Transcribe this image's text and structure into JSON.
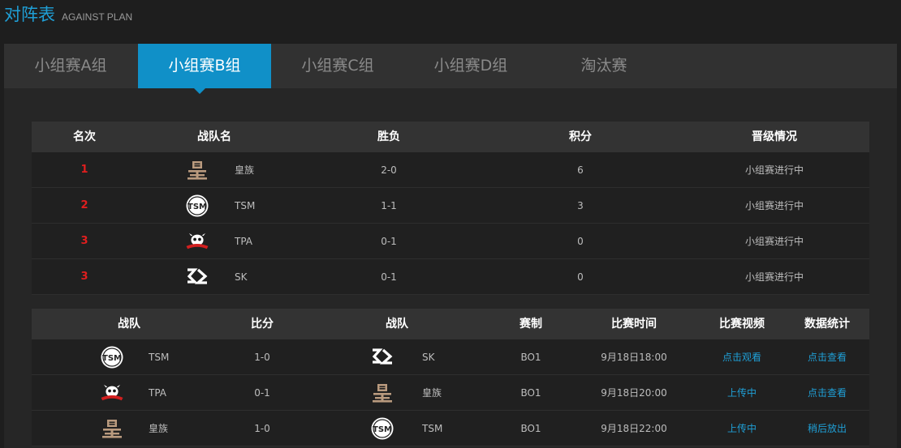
{
  "header": {
    "title": "对阵表",
    "subtitle": "AGAINST PLAN"
  },
  "tabs": [
    {
      "label": "小组赛A组",
      "active": false
    },
    {
      "label": "小组赛B组",
      "active": true
    },
    {
      "label": "小组赛C组",
      "active": false
    },
    {
      "label": "小组赛D组",
      "active": false
    },
    {
      "label": "淘汰赛",
      "active": false
    }
  ],
  "standings": {
    "headers": [
      "名次",
      "战队名",
      "胜负",
      "积分",
      "晋级情况"
    ],
    "rows": [
      {
        "rank": "1",
        "logo": "royal-club-logo",
        "team": "皇族",
        "record": "2-0",
        "points": "6",
        "status": "小组赛进行中"
      },
      {
        "rank": "2",
        "logo": "tsm-logo",
        "team": "TSM",
        "record": "1-1",
        "points": "3",
        "status": "小组赛进行中"
      },
      {
        "rank": "3",
        "logo": "tpa-logo",
        "team": "TPA",
        "record": "0-1",
        "points": "0",
        "status": "小组赛进行中"
      },
      {
        "rank": "3",
        "logo": "sk-logo",
        "team": "SK",
        "record": "0-1",
        "points": "0",
        "status": "小组赛进行中"
      }
    ]
  },
  "matches": {
    "headers": [
      "战队",
      "比分",
      "战队",
      "赛制",
      "比赛时间",
      "比赛视频",
      "数据统计"
    ],
    "rows": [
      {
        "team1_logo": "tsm-logo",
        "team1": "TSM",
        "score": "1-0",
        "team2_logo": "sk-logo",
        "team2": "SK",
        "format": "BO1",
        "time": "9月18日18:00",
        "video": "点击观看",
        "video_link": true,
        "stats": "点击查看",
        "stats_link": true
      },
      {
        "team1_logo": "tpa-logo",
        "team1": "TPA",
        "score": "0-1",
        "team2_logo": "royal-club-logo",
        "team2": "皇族",
        "format": "BO1",
        "time": "9月18日20:00",
        "video": "上传中",
        "video_link": true,
        "stats": "点击查看",
        "stats_link": true
      },
      {
        "team1_logo": "royal-club-logo",
        "team1": "皇族",
        "score": "1-0",
        "team2_logo": "tsm-logo",
        "team2": "TSM",
        "format": "BO1",
        "time": "9月18日22:00",
        "video": "上传中",
        "video_link": true,
        "stats": "稍后放出",
        "stats_link": true
      }
    ]
  },
  "colors": {
    "accent": "#1090c8",
    "rank": "#e01e1e",
    "link": "#1f9fd6"
  }
}
